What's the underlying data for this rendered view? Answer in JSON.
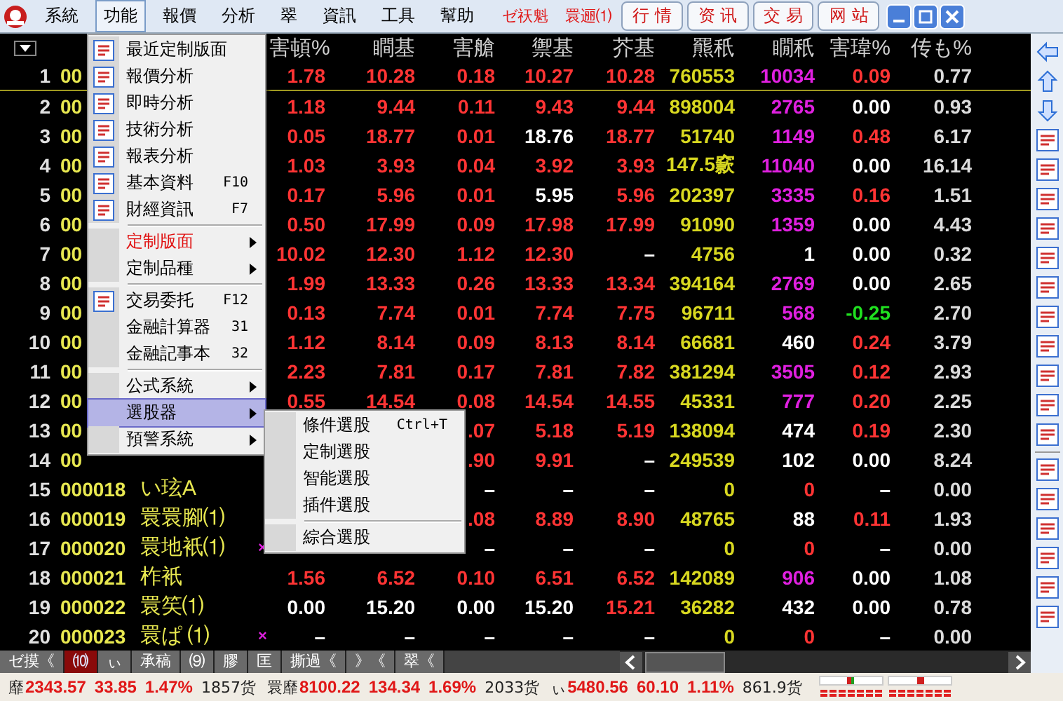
{
  "menubar": {
    "items": [
      {
        "label": "系統",
        "selected": false
      },
      {
        "label": "功能",
        "selected": true
      },
      {
        "label": "報價",
        "selected": false
      },
      {
        "label": "分析",
        "selected": false
      },
      {
        "label": "翠",
        "selected": false
      },
      {
        "label": "資訊",
        "selected": false
      },
      {
        "label": "工具",
        "selected": false
      },
      {
        "label": "幫助",
        "selected": false
      }
    ],
    "alerts": [
      "ゼ祆魁",
      "睘逦⑴"
    ],
    "links": [
      "行 情",
      "资 讯",
      "交 易",
      "网 站"
    ]
  },
  "menu": {
    "items": [
      {
        "kind": "item",
        "label": "最近定制版面",
        "selected": false,
        "emphasized": false,
        "submenu": false
      },
      {
        "kind": "item",
        "label": "報價分析",
        "selected": false,
        "emphasized": false,
        "submenu": false
      },
      {
        "kind": "item",
        "label": "即時分析",
        "selected": false,
        "emphasized": false,
        "submenu": false
      },
      {
        "kind": "item",
        "label": "技術分析",
        "selected": false,
        "emphasized": false,
        "submenu": false
      },
      {
        "kind": "item",
        "label": "報表分析",
        "selected": false,
        "emphasized": false,
        "submenu": false
      },
      {
        "kind": "item",
        "label": "基本資料",
        "shortcut": "F10",
        "selected": false,
        "emphasized": false,
        "submenu": false
      },
      {
        "kind": "item",
        "label": "財經資訊",
        "shortcut": "F7",
        "selected": false,
        "emphasized": false,
        "submenu": false
      },
      {
        "kind": "separator"
      },
      {
        "kind": "item",
        "label": "定制版面",
        "selected": false,
        "emphasized": true,
        "submenu": true
      },
      {
        "kind": "item",
        "label": "定制品種",
        "selected": false,
        "emphasized": false,
        "submenu": true
      },
      {
        "kind": "separator"
      },
      {
        "kind": "item",
        "label": "交易委托",
        "shortcut": "F12",
        "selected": false,
        "emphasized": false,
        "submenu": false
      },
      {
        "kind": "item",
        "label": "金融計算器",
        "shortcut": "31",
        "selected": false,
        "emphasized": false,
        "submenu": false
      },
      {
        "kind": "item",
        "label": "金融記事本",
        "shortcut": "32",
        "selected": false,
        "emphasized": false,
        "submenu": false
      },
      {
        "kind": "separator"
      },
      {
        "kind": "item",
        "label": "公式系統",
        "selected": false,
        "emphasized": false,
        "submenu": true
      },
      {
        "kind": "item",
        "label": "選股器",
        "selected": true,
        "emphasized": false,
        "submenu": true
      },
      {
        "kind": "item",
        "label": "預警系統",
        "selected": false,
        "emphasized": false,
        "submenu": true
      }
    ]
  },
  "submenu": {
    "items": [
      {
        "kind": "item",
        "label": "條件選股",
        "shortcut": "Ctrl+T"
      },
      {
        "kind": "item",
        "label": "定制選股"
      },
      {
        "kind": "item",
        "label": "智能選股"
      },
      {
        "kind": "item",
        "label": "插件選股"
      },
      {
        "kind": "separator"
      },
      {
        "kind": "item",
        "label": "綜合選股"
      }
    ]
  },
  "table": {
    "columns": [
      "害頓%",
      "瞷基",
      "害艙",
      "禦基",
      "芥基",
      "羆秖",
      "瞯秖",
      "害瑋%",
      "传も%"
    ],
    "rows": [
      {
        "num": "1",
        "code": "00",
        "cells": [
          {
            "text": "1.78",
            "color": "#ff3434"
          },
          {
            "text": "10.28",
            "color": "#ff3434"
          },
          {
            "text": "0.18",
            "color": "#ff3434"
          },
          {
            "text": "10.27",
            "color": "#ff3434"
          },
          {
            "text": "10.28",
            "color": "#ff3434"
          },
          {
            "text": "760553",
            "color": "#d8d820"
          },
          {
            "text": "10034",
            "color": "#e020e0"
          },
          {
            "text": "0.09",
            "color": "#ff3434"
          },
          {
            "text": "0.77",
            "color": "#dcdcdc"
          }
        ]
      },
      {
        "num": "2",
        "code": "00",
        "cells": [
          {
            "text": "1.18",
            "color": "#ff3434"
          },
          {
            "text": "9.44",
            "color": "#ff3434"
          },
          {
            "text": "0.11",
            "color": "#ff3434"
          },
          {
            "text": "9.43",
            "color": "#ff3434"
          },
          {
            "text": "9.44",
            "color": "#ff3434"
          },
          {
            "text": "898004",
            "color": "#d8d820"
          },
          {
            "text": "2765",
            "color": "#e020e0"
          },
          {
            "text": "0.00",
            "color": "#ffffff"
          },
          {
            "text": "0.93",
            "color": "#dcdcdc"
          }
        ]
      },
      {
        "num": "3",
        "code": "00",
        "cells": [
          {
            "text": "0.05",
            "color": "#ff3434"
          },
          {
            "text": "18.77",
            "color": "#ff3434"
          },
          {
            "text": "0.01",
            "color": "#ff3434"
          },
          {
            "text": "18.76",
            "color": "#ffffff"
          },
          {
            "text": "18.77",
            "color": "#ff3434"
          },
          {
            "text": "51740",
            "color": "#d8d820"
          },
          {
            "text": "1149",
            "color": "#e020e0"
          },
          {
            "text": "0.48",
            "color": "#ff3434"
          },
          {
            "text": "6.17",
            "color": "#dcdcdc"
          }
        ]
      },
      {
        "num": "4",
        "code": "00",
        "cells": [
          {
            "text": "1.03",
            "color": "#ff3434"
          },
          {
            "text": "3.93",
            "color": "#ff3434"
          },
          {
            "text": "0.04",
            "color": "#ff3434"
          },
          {
            "text": "3.92",
            "color": "#ff3434"
          },
          {
            "text": "3.93",
            "color": "#ff3434"
          },
          {
            "text": "147.5窾",
            "color": "#d8d820"
          },
          {
            "text": "11040",
            "color": "#e020e0"
          },
          {
            "text": "0.00",
            "color": "#ffffff"
          },
          {
            "text": "16.14",
            "color": "#dcdcdc"
          }
        ]
      },
      {
        "num": "5",
        "code": "00",
        "cells": [
          {
            "text": "0.17",
            "color": "#ff3434"
          },
          {
            "text": "5.96",
            "color": "#ff3434"
          },
          {
            "text": "0.01",
            "color": "#ff3434"
          },
          {
            "text": "5.95",
            "color": "#ffffff"
          },
          {
            "text": "5.96",
            "color": "#ff3434"
          },
          {
            "text": "202397",
            "color": "#d8d820"
          },
          {
            "text": "3335",
            "color": "#e020e0"
          },
          {
            "text": "0.16",
            "color": "#ff3434"
          },
          {
            "text": "1.51",
            "color": "#dcdcdc"
          }
        ]
      },
      {
        "num": "6",
        "code": "00",
        "cells": [
          {
            "text": "0.50",
            "color": "#ff3434"
          },
          {
            "text": "17.99",
            "color": "#ff3434"
          },
          {
            "text": "0.09",
            "color": "#ff3434"
          },
          {
            "text": "17.98",
            "color": "#ff3434"
          },
          {
            "text": "17.99",
            "color": "#ff3434"
          },
          {
            "text": "91090",
            "color": "#d8d820"
          },
          {
            "text": "1359",
            "color": "#e020e0"
          },
          {
            "text": "0.00",
            "color": "#ffffff"
          },
          {
            "text": "4.43",
            "color": "#dcdcdc"
          }
        ]
      },
      {
        "num": "7",
        "code": "00",
        "cells": [
          {
            "text": "10.02",
            "color": "#ff3434"
          },
          {
            "text": "12.30",
            "color": "#ff3434"
          },
          {
            "text": "1.12",
            "color": "#ff3434"
          },
          {
            "text": "12.30",
            "color": "#ff3434"
          },
          {
            "text": "–",
            "color": "#ffffff"
          },
          {
            "text": "4756",
            "color": "#d8d820"
          },
          {
            "text": "1",
            "color": "#ffffff"
          },
          {
            "text": "0.00",
            "color": "#ffffff"
          },
          {
            "text": "0.32",
            "color": "#dcdcdc"
          }
        ]
      },
      {
        "num": "8",
        "code": "00",
        "cells": [
          {
            "text": "1.99",
            "color": "#ff3434"
          },
          {
            "text": "13.33",
            "color": "#ff3434"
          },
          {
            "text": "0.26",
            "color": "#ff3434"
          },
          {
            "text": "13.33",
            "color": "#ff3434"
          },
          {
            "text": "13.34",
            "color": "#ff3434"
          },
          {
            "text": "394164",
            "color": "#d8d820"
          },
          {
            "text": "2769",
            "color": "#e020e0"
          },
          {
            "text": "0.00",
            "color": "#ffffff"
          },
          {
            "text": "2.65",
            "color": "#dcdcdc"
          }
        ]
      },
      {
        "num": "9",
        "code": "00",
        "cells": [
          {
            "text": "0.13",
            "color": "#ff3434"
          },
          {
            "text": "7.74",
            "color": "#ff3434"
          },
          {
            "text": "0.01",
            "color": "#ff3434"
          },
          {
            "text": "7.74",
            "color": "#ff3434"
          },
          {
            "text": "7.75",
            "color": "#ff3434"
          },
          {
            "text": "96711",
            "color": "#d8d820"
          },
          {
            "text": "568",
            "color": "#e020e0"
          },
          {
            "text": "-0.25",
            "color": "#20e020"
          },
          {
            "text": "2.70",
            "color": "#dcdcdc"
          }
        ]
      },
      {
        "num": "10",
        "code": "00",
        "cells": [
          {
            "text": "1.12",
            "color": "#ff3434"
          },
          {
            "text": "8.14",
            "color": "#ff3434"
          },
          {
            "text": "0.09",
            "color": "#ff3434"
          },
          {
            "text": "8.13",
            "color": "#ff3434"
          },
          {
            "text": "8.14",
            "color": "#ff3434"
          },
          {
            "text": "66681",
            "color": "#d8d820"
          },
          {
            "text": "460",
            "color": "#ffffff"
          },
          {
            "text": "0.24",
            "color": "#ff3434"
          },
          {
            "text": "3.79",
            "color": "#dcdcdc"
          }
        ]
      },
      {
        "num": "11",
        "code": "00",
        "cells": [
          {
            "text": "2.23",
            "color": "#ff3434"
          },
          {
            "text": "7.81",
            "color": "#ff3434"
          },
          {
            "text": "0.17",
            "color": "#ff3434"
          },
          {
            "text": "7.81",
            "color": "#ff3434"
          },
          {
            "text": "7.82",
            "color": "#ff3434"
          },
          {
            "text": "381294",
            "color": "#d8d820"
          },
          {
            "text": "3505",
            "color": "#e020e0"
          },
          {
            "text": "0.12",
            "color": "#ff3434"
          },
          {
            "text": "2.93",
            "color": "#dcdcdc"
          }
        ]
      },
      {
        "num": "12",
        "code": "00",
        "cells": [
          {
            "text": "0.55",
            "color": "#ff3434"
          },
          {
            "text": "14.54",
            "color": "#ff3434"
          },
          {
            "text": "0.08",
            "color": "#ff3434"
          },
          {
            "text": "14.54",
            "color": "#ff3434"
          },
          {
            "text": "14.55",
            "color": "#ff3434"
          },
          {
            "text": "45331",
            "color": "#d8d820"
          },
          {
            "text": "777",
            "color": "#e020e0"
          },
          {
            "text": "0.20",
            "color": "#ff3434"
          },
          {
            "text": "2.25",
            "color": "#dcdcdc"
          }
        ]
      },
      {
        "num": "13",
        "code": "00",
        "cells": [
          null,
          null,
          {
            "text": ".07",
            "color": "#ff3434"
          },
          {
            "text": "5.18",
            "color": "#ff3434"
          },
          {
            "text": "5.19",
            "color": "#ff3434"
          },
          {
            "text": "138094",
            "color": "#d8d820"
          },
          {
            "text": "474",
            "color": "#ffffff"
          },
          {
            "text": "0.19",
            "color": "#ff3434"
          },
          {
            "text": "2.30",
            "color": "#dcdcdc"
          }
        ]
      },
      {
        "num": "14",
        "code": "00",
        "cells": [
          null,
          null,
          {
            "text": ".90",
            "color": "#ff3434"
          },
          {
            "text": "9.91",
            "color": "#ff3434"
          },
          {
            "text": "–",
            "color": "#ffffff"
          },
          {
            "text": "249539",
            "color": "#d8d820"
          },
          {
            "text": "102",
            "color": "#ffffff"
          },
          {
            "text": "0.00",
            "color": "#ffffff"
          },
          {
            "text": "8.24",
            "color": "#dcdcdc"
          }
        ]
      },
      {
        "num": "15",
        "code": "000018",
        "name": "い玹A",
        "cells": [
          null,
          null,
          {
            "text": "–",
            "color": "#ffffff"
          },
          {
            "text": "–",
            "color": "#ffffff"
          },
          {
            "text": "–",
            "color": "#ffffff"
          },
          {
            "text": "0",
            "color": "#d8d820"
          },
          {
            "text": "0",
            "color": "#ff3434"
          },
          {
            "text": "–",
            "color": "#ffffff"
          },
          {
            "text": "0.00",
            "color": "#dcdcdc"
          }
        ]
      },
      {
        "num": "16",
        "code": "000019",
        "name": "睘睘腳⑴",
        "cells": [
          null,
          null,
          {
            "text": ".08",
            "color": "#ff3434"
          },
          {
            "text": "8.89",
            "color": "#ff3434"
          },
          {
            "text": "8.90",
            "color": "#ff3434"
          },
          {
            "text": "48765",
            "color": "#d8d820"
          },
          {
            "text": "88",
            "color": "#ffffff"
          },
          {
            "text": "0.11",
            "color": "#ff3434"
          },
          {
            "text": "1.93",
            "color": "#dcdcdc"
          }
        ]
      },
      {
        "num": "17",
        "code": "000020",
        "name": "睘地衹⑴",
        "flag": "×",
        "cells": [
          null,
          null,
          {
            "text": "–",
            "color": "#ffffff"
          },
          {
            "text": "–",
            "color": "#ffffff"
          },
          {
            "text": "–",
            "color": "#ffffff"
          },
          {
            "text": "0",
            "color": "#d8d820"
          },
          {
            "text": "0",
            "color": "#ff3434"
          },
          {
            "text": "–",
            "color": "#ffffff"
          },
          {
            "text": "0.00",
            "color": "#dcdcdc"
          }
        ]
      },
      {
        "num": "18",
        "code": "000021",
        "name": "柞衹",
        "cells": [
          {
            "text": "1.56",
            "color": "#ff3434"
          },
          {
            "text": "6.52",
            "color": "#ff3434"
          },
          {
            "text": "0.10",
            "color": "#ff3434"
          },
          {
            "text": "6.51",
            "color": "#ff3434"
          },
          {
            "text": "6.52",
            "color": "#ff3434"
          },
          {
            "text": "142089",
            "color": "#d8d820"
          },
          {
            "text": "906",
            "color": "#e020e0"
          },
          {
            "text": "0.00",
            "color": "#ffffff"
          },
          {
            "text": "1.08",
            "color": "#dcdcdc"
          }
        ]
      },
      {
        "num": "19",
        "code": "000022",
        "name": "睘笶⑴",
        "cells": [
          {
            "text": "0.00",
            "color": "#ffffff"
          },
          {
            "text": "15.20",
            "color": "#ffffff"
          },
          {
            "text": "0.00",
            "color": "#ffffff"
          },
          {
            "text": "15.20",
            "color": "#ffffff"
          },
          {
            "text": "15.21",
            "color": "#ff3434"
          },
          {
            "text": "36282",
            "color": "#d8d820"
          },
          {
            "text": "432",
            "color": "#ffffff"
          },
          {
            "text": "0.00",
            "color": "#ffffff"
          },
          {
            "text": "0.78",
            "color": "#dcdcdc"
          }
        ]
      },
      {
        "num": "20",
        "code": "000023",
        "name": "睘ぱ ⑴",
        "flag": "×",
        "cells": [
          {
            "text": "–",
            "color": "#ffffff"
          },
          {
            "text": "–",
            "color": "#ffffff"
          },
          {
            "text": "–",
            "color": "#ffffff"
          },
          {
            "text": "–",
            "color": "#ffffff"
          },
          {
            "text": "–",
            "color": "#ffffff"
          },
          {
            "text": "0",
            "color": "#d8d820"
          },
          {
            "text": "0",
            "color": "#ff3434"
          },
          {
            "text": "–",
            "color": "#ffffff"
          },
          {
            "text": "0.00",
            "color": "#dcdcdc"
          }
        ]
      }
    ]
  },
  "tabs": [
    {
      "label": "ゼ摸《",
      "selected": false
    },
    {
      "label": "⑽",
      "selected": true
    },
    {
      "label": "ぃ",
      "selected": false
    },
    {
      "label": "承稿",
      "selected": false
    },
    {
      "label": "⑼",
      "selected": false
    },
    {
      "label": "膠",
      "selected": false
    },
    {
      "label": "匡",
      "selected": false
    },
    {
      "label": "撕過《",
      "selected": false
    },
    {
      "label": "》《",
      "selected": false
    },
    {
      "label": "翠《",
      "selected": false
    }
  ],
  "status_bar": {
    "indices": [
      {
        "name": "靡",
        "value": "2343.57",
        "change": "33.85",
        "percent": "1.47%",
        "volume": "1857货"
      },
      {
        "name": "睘靡",
        "value": "8100.22",
        "change": "134.34",
        "percent": "1.69%",
        "volume": "2033货"
      },
      {
        "name": "ぃ",
        "value": "5480.56",
        "change": "60.10",
        "percent": "1.11%",
        "volume": "861.9货"
      }
    ]
  }
}
